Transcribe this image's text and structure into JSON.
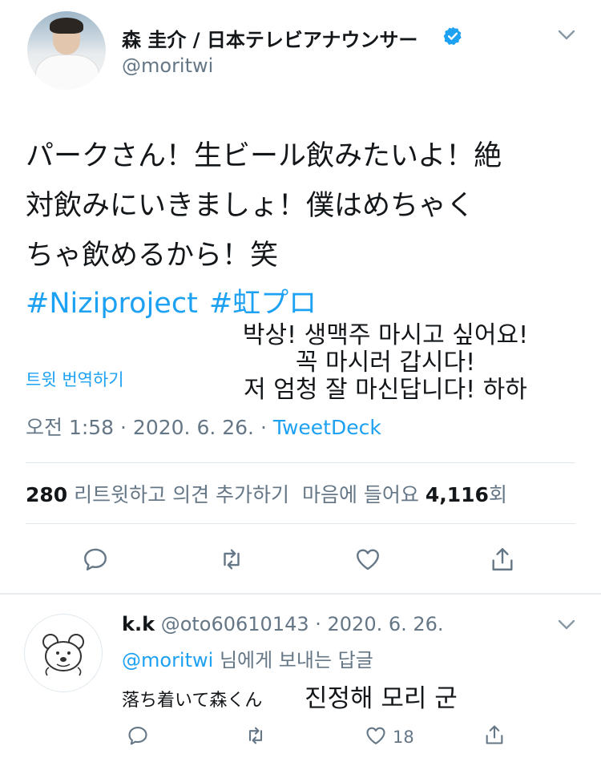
{
  "tweet": {
    "author_name": "森 圭介 / 日本テレビアナウンサー",
    "author_handle": "@moritwi",
    "body": "パークさん！生ビール飲みたいよ！絶\n対飲みにいきましょ！僕はめちゃく\nちゃ飲めるから！笑",
    "hashtags": [
      "#Niziproject",
      "#虹プロ"
    ],
    "translate_label": "트윗 번역하기",
    "timestamp": "오전 1:58 · 2020. 6. 26. · ",
    "source": "TweetDeck"
  },
  "overlay_translation": "박상! 생맥주 마시고 싶어요!\n꼭 마시러 갑시다!\n저 엄청 잘 마신답니다! 하하",
  "stats": {
    "retweets": "280",
    "retweets_label": "리트윗하고 의견 추가하기",
    "likes_label": "마음에 들어요",
    "likes": "4,116",
    "likes_unit": "회"
  },
  "reply": {
    "name": "k.k",
    "meta": "@oto60610143 · 2020. 6. 26.",
    "reply_to_handle": "@moritwi",
    "reply_to_suffix": " 님에게 보내는 답글",
    "text": "落ち着いて森くん",
    "translation": "진정해 모리 군",
    "like_count": "18"
  },
  "icons": {
    "verified": "verified-badge-icon",
    "chevron": "chevron-down-icon",
    "reply": "reply-icon",
    "retweet": "retweet-icon",
    "like": "heart-icon",
    "share": "share-icon"
  },
  "colors": {
    "link": "#1da1f2",
    "secondary": "#657786",
    "text": "#14171a",
    "icon": "#657786"
  }
}
